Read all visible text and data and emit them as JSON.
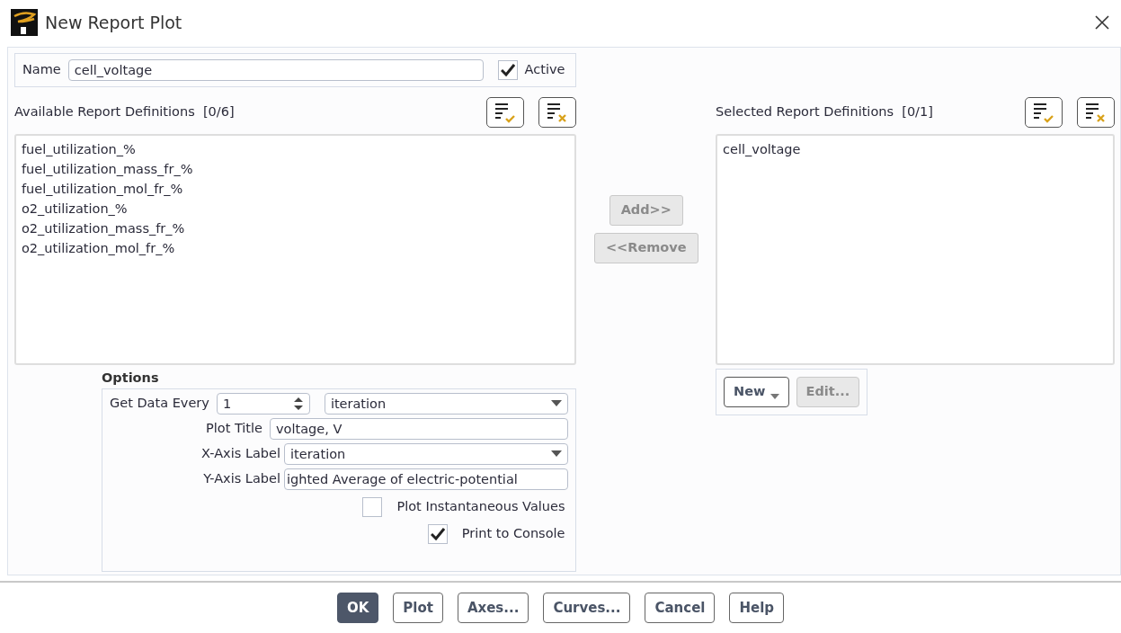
{
  "window": {
    "title": "New Report Plot"
  },
  "name_field": {
    "label": "Name",
    "value": "cell_voltage"
  },
  "active": {
    "label": "Active",
    "checked": true
  },
  "available": {
    "label": "Available Report Definitions",
    "count": "[0/6]",
    "items": [
      {
        "label": "fuel_utilization_%",
        "selected": false
      },
      {
        "label": "fuel_utilization_mass_fr_%",
        "selected": false
      },
      {
        "label": "fuel_utilization_mol_fr_%",
        "selected": false
      },
      {
        "label": "o2_utilization_%",
        "selected": false
      },
      {
        "label": "o2_utilization_mass_fr_%",
        "selected": false
      },
      {
        "label": "o2_utilization_mol_fr_%",
        "selected": false
      }
    ]
  },
  "transfer_buttons": [
    {
      "label": "Add>>",
      "disabled": true
    },
    {
      "label": "<<Remove",
      "disabled": true
    }
  ],
  "selected_definitions": {
    "label": "Selected Report Definitions",
    "count": "[0/1]",
    "items": [
      {
        "label": "cell_voltage",
        "selected": false
      }
    ]
  },
  "definition_buttons": [
    {
      "label": "New",
      "kind": "dropdown",
      "disabled": false
    },
    {
      "label": "Edit...",
      "kind": "plain",
      "disabled": true
    }
  ],
  "options": {
    "title": "Options",
    "get_data_every": {
      "label": "Get Data Every",
      "value": "1",
      "unit": "iteration"
    },
    "plot_title": {
      "label": "Plot Title",
      "value": "voltage, V"
    },
    "x_axis_label": {
      "label": "X-Axis Label",
      "value": "iteration"
    },
    "y_axis_label": {
      "label": "Y-Axis Label",
      "value": "ighted Average of electric-potential"
    },
    "checkboxes": [
      {
        "label": "Plot Instantaneous Values",
        "checked": false
      },
      {
        "label": "Print to Console",
        "checked": true
      }
    ]
  },
  "footer_buttons": [
    {
      "label": "OK",
      "kind": "primary"
    },
    {
      "label": "Plot",
      "kind": "default"
    },
    {
      "label": "Axes...",
      "kind": "default"
    },
    {
      "label": "Curves...",
      "kind": "default"
    },
    {
      "label": "Cancel",
      "kind": "default"
    },
    {
      "label": "Help",
      "kind": "default"
    }
  ]
}
